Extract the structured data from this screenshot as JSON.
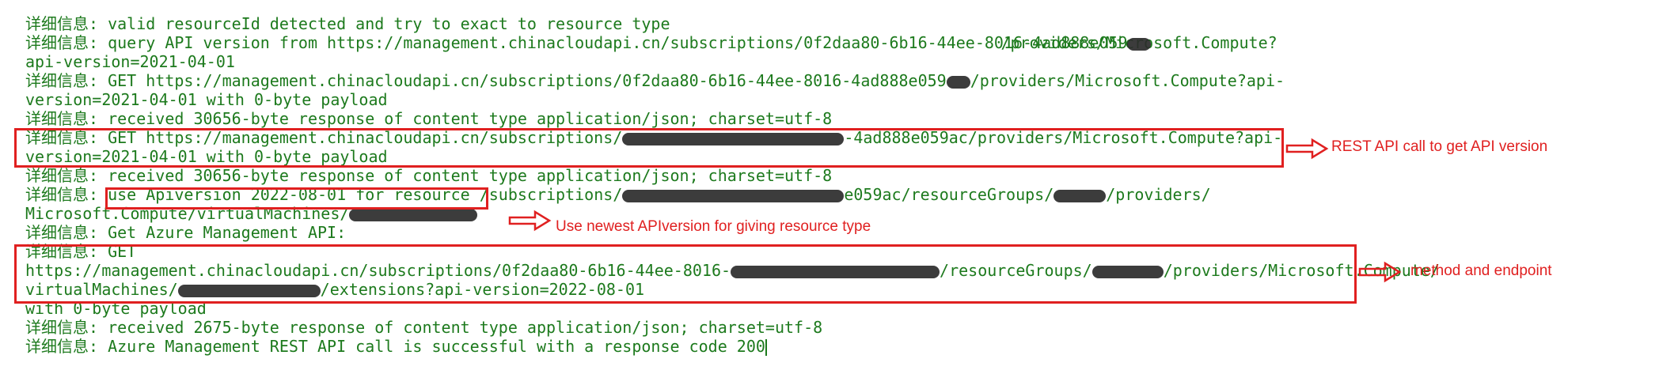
{
  "prefix": "详细信息: ",
  "lines": {
    "l1": "valid resourceId detected and try to exact to resource type",
    "l2a": "query API version from https://management.chinacloudapi.cn/subscriptions/0f2daa80-6b16-44ee-8016-4ad888e059",
    "l2b": "/providers/Microsoft.Compute?",
    "l3": "api-version=2021-04-01",
    "l4a": "GET https://management.chinacloudapi.cn/subscriptions/0f2daa80-6b16-44ee-8016-4ad888e059",
    "l4b": "/providers/Microsoft.Compute?api-",
    "l5": "version=2021-04-01 with 0-byte payload",
    "l6": "received 30656-byte response of content type application/json; charset=utf-8",
    "l7a": "GET https://management.chinacloudapi.cn/subscriptions/",
    "l7b": "-4ad888e059ac/providers/Microsoft.Compute?api-",
    "l8": "version=2021-04-01 with 0-byte payload",
    "l9": "received 30656-byte response of content type application/json; charset=utf-8",
    "l10a": "use Apiversion 2022-08-01 for resource ",
    "l10b": "/subscriptions/",
    "l10c": "e059ac/resourceGroups/",
    "l10d": "/providers/",
    "l11a": "Microsoft.Compute/virtualMachines/",
    "l12": "Get Azure Management API:",
    "l13": "GET",
    "l14a": "https://management.chinacloudapi.cn/subscriptions/0f2daa80-6b16-44ee-8016-",
    "l14b": "/resourceGroups/",
    "l14c": "/providers/Microsoft.Compute/",
    "l15a": "virtualMachines/",
    "l15b": "/extensions?api-version=2022-08-01",
    "l16": "with 0-byte payload",
    "l17": "received 2675-byte response of content type application/json; charset=utf-8",
    "l18": "Azure Management REST API call is successful with a response code 200"
  },
  "annotations": {
    "rest_api_call": "REST API call to get API version",
    "newest_apiversion": "Use newest APIversion for giving resource type",
    "method_endpoint": "method and endpoint"
  },
  "colors": {
    "console_text": "#1d7a1d",
    "annotation": "#e02020",
    "redaction": "#2b2b2b"
  }
}
